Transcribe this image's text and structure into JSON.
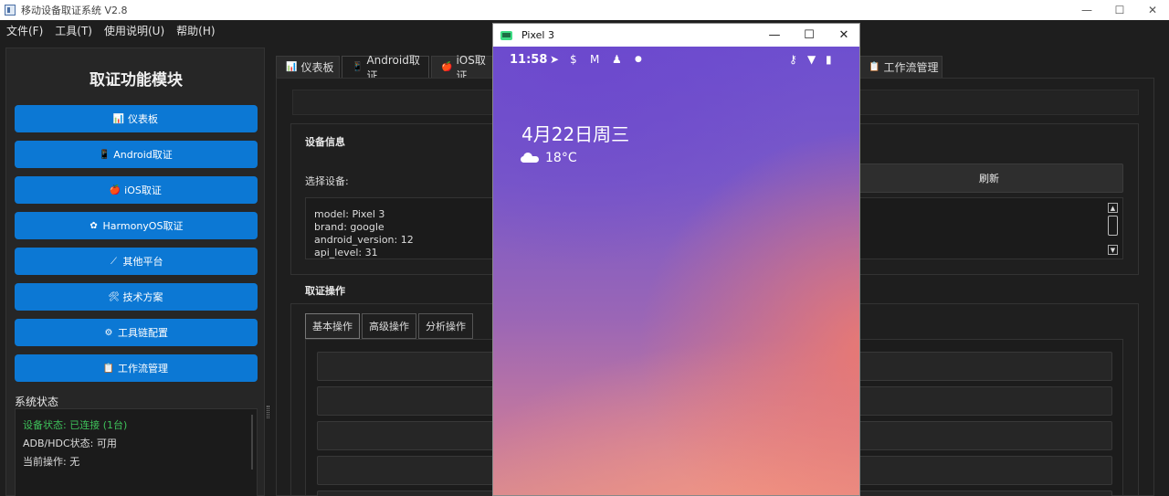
{
  "app": {
    "title": "移动设备取证系统 V2.8",
    "window_controls": [
      "—",
      "☐",
      "✕"
    ]
  },
  "menu": [
    "文件(F)",
    "工具(T)",
    "使用说明(U)",
    "帮助(H)"
  ],
  "sidebar": {
    "title": "取证功能模块",
    "items": [
      {
        "label": "仪表板",
        "icon": "📊"
      },
      {
        "label": "Android取证",
        "icon": "📱"
      },
      {
        "label": "iOS取证",
        "icon": "🍎"
      },
      {
        "label": "HarmonyOS取证",
        "icon": "✿"
      },
      {
        "label": "其他平台",
        "icon": "⟋"
      },
      {
        "label": "技术方案",
        "icon": "🛠"
      },
      {
        "label": "工具链配置",
        "icon": "⚙"
      },
      {
        "label": "工作流管理",
        "icon": "📋"
      }
    ],
    "status_title": "系统状态",
    "status": {
      "device": "设备状态: 已连接 (1台)",
      "adb": "ADB/HDC状态: 可用",
      "operation": "当前操作: 无"
    }
  },
  "tabs": [
    {
      "label": "仪表板",
      "icon": "📊"
    },
    {
      "label": "Android取证",
      "icon": "📱"
    },
    {
      "label": "iOS取证",
      "icon": "🍎"
    },
    {
      "label": "工作流管理",
      "icon": "📋"
    }
  ],
  "device_info": {
    "group_title": "设备信息",
    "select_label": "选择设备:",
    "refresh_label": "刷新",
    "lines": [
      "model: Pixel 3",
      "brand: google",
      "android_version: 12",
      "api_level: 31"
    ]
  },
  "operations": {
    "group_title": "取证操作",
    "subtabs": [
      "基本操作",
      "高级操作",
      "分析操作"
    ]
  },
  "emulator": {
    "title": "Pixel 3",
    "controls": [
      "—",
      "☐",
      "✕"
    ],
    "time": "11:58",
    "date": "4月22日周三",
    "temperature": "18°C"
  }
}
